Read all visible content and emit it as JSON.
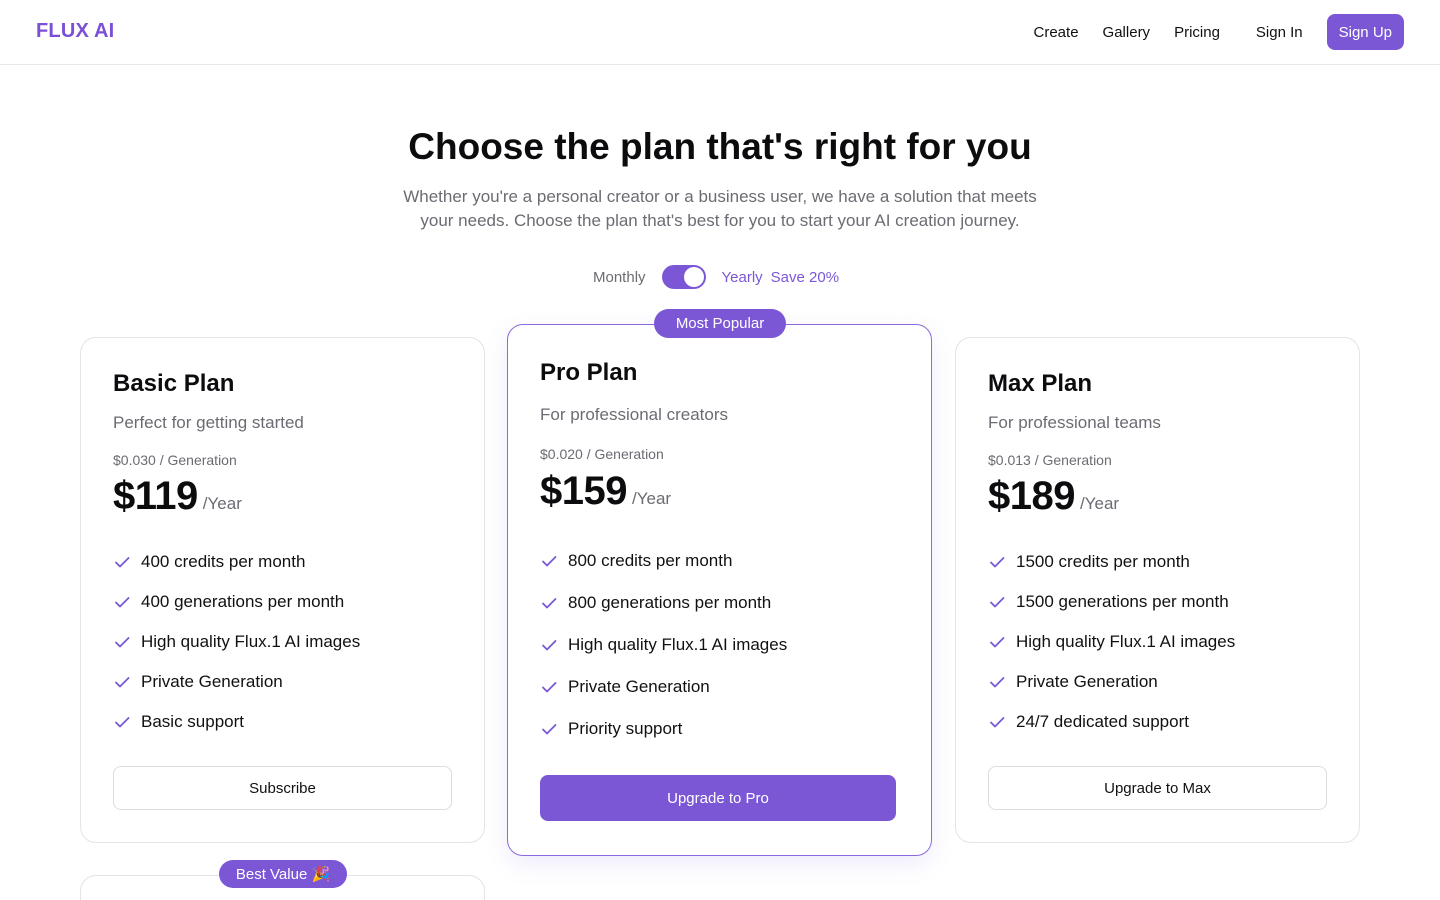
{
  "brand": {
    "logo": "FLUX AI",
    "accent": "#7b57d6"
  },
  "nav": {
    "create": "Create",
    "gallery": "Gallery",
    "pricing": "Pricing",
    "signin": "Sign In",
    "signup": "Sign Up"
  },
  "hero": {
    "title": "Choose the plan that's right for you",
    "subtitle": "Whether you're a personal creator or a business user, we have a solution that meets your needs. Choose the plan that's best for you to start your AI creation journey."
  },
  "billing": {
    "monthly": "Monthly",
    "yearly": "Yearly",
    "save": "Save 20%",
    "yearly_selected": true
  },
  "plans": [
    {
      "name": "Basic Plan",
      "desc": "Perfect for getting started",
      "rate": "$0.030 / Generation",
      "price": "$119",
      "period": "/Year",
      "features": [
        "400 credits per month",
        "400 generations per month",
        "High quality Flux.1 AI images",
        "Private Generation",
        "Basic support"
      ],
      "cta": "Subscribe"
    },
    {
      "name": "Pro Plan",
      "badge": "Most Popular",
      "desc": "For professional creators",
      "rate": "$0.020 / Generation",
      "price": "$159",
      "period": "/Year",
      "features": [
        "800 credits per month",
        "800 generations per month",
        "High quality Flux.1 AI images",
        "Private Generation",
        "Priority support"
      ],
      "cta": "Upgrade to Pro"
    },
    {
      "name": "Max Plan",
      "desc": "For professional teams",
      "rate": "$0.013 / Generation",
      "price": "$189",
      "period": "/Year",
      "features": [
        "1500 credits per month",
        "1500 generations per month",
        "High quality Flux.1 AI images",
        "Private Generation",
        "24/7 dedicated support"
      ],
      "cta": "Upgrade to Max"
    }
  ],
  "extra_badge": "Best Value 🎉"
}
